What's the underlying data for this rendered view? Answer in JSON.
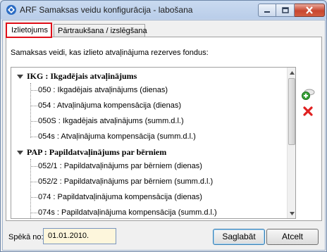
{
  "window": {
    "title": "ARF Samaksas veidu konfigurācija - labošana",
    "controls": {
      "minimize": "minimize",
      "maximize": "maximize",
      "close": "close"
    }
  },
  "tabs": [
    {
      "label": "Izlietojums",
      "active": true
    },
    {
      "label": "Pārtraukšana / izslēgšana",
      "active": false
    }
  ],
  "panel": {
    "description": "Samaksas veidi, kas izlieto atvaļinājuma rezerves fondus:"
  },
  "tree": {
    "groups": [
      {
        "label": "IKG : Ikgadējais atvaļinājums",
        "expanded": true,
        "items": [
          "050 : Ikgadējais  atvaļinājums (dienas)",
          "054 : Atvaļinājuma kompensācija (dienas)",
          "050S : Ikgadējais  atvaļinājums (summ.d.l.)",
          "054s : Atvaļinājuma kompensācija (summ.d.l.)"
        ]
      },
      {
        "label": "PAP : Papildatvaļinājums par bērniem",
        "expanded": true,
        "items": [
          "052/1 : Papildatvaļinājums par bērniem (dienas)",
          "052/2 : Papildatvaļinājums par bērniem (summ.d.l.)",
          "074 : Papildatvaļinājuma kompensācija (dienas)",
          "074s : Papildatvaļinājuma kompensācija (summ.d.l.)"
        ]
      }
    ]
  },
  "side_actions": {
    "add_icon": "add-green-plus-icon",
    "delete_icon": "delete-red-x-icon"
  },
  "footer": {
    "valid_from_label": "Spēkā no:",
    "valid_from_value": "01.01.2010.",
    "save_label": "Saglabāt",
    "cancel_label": "Atcelt"
  },
  "colors": {
    "active_tab_border": "#e0101a",
    "date_field_bg": "#fdf6dc",
    "close_button": "#c8462f"
  }
}
